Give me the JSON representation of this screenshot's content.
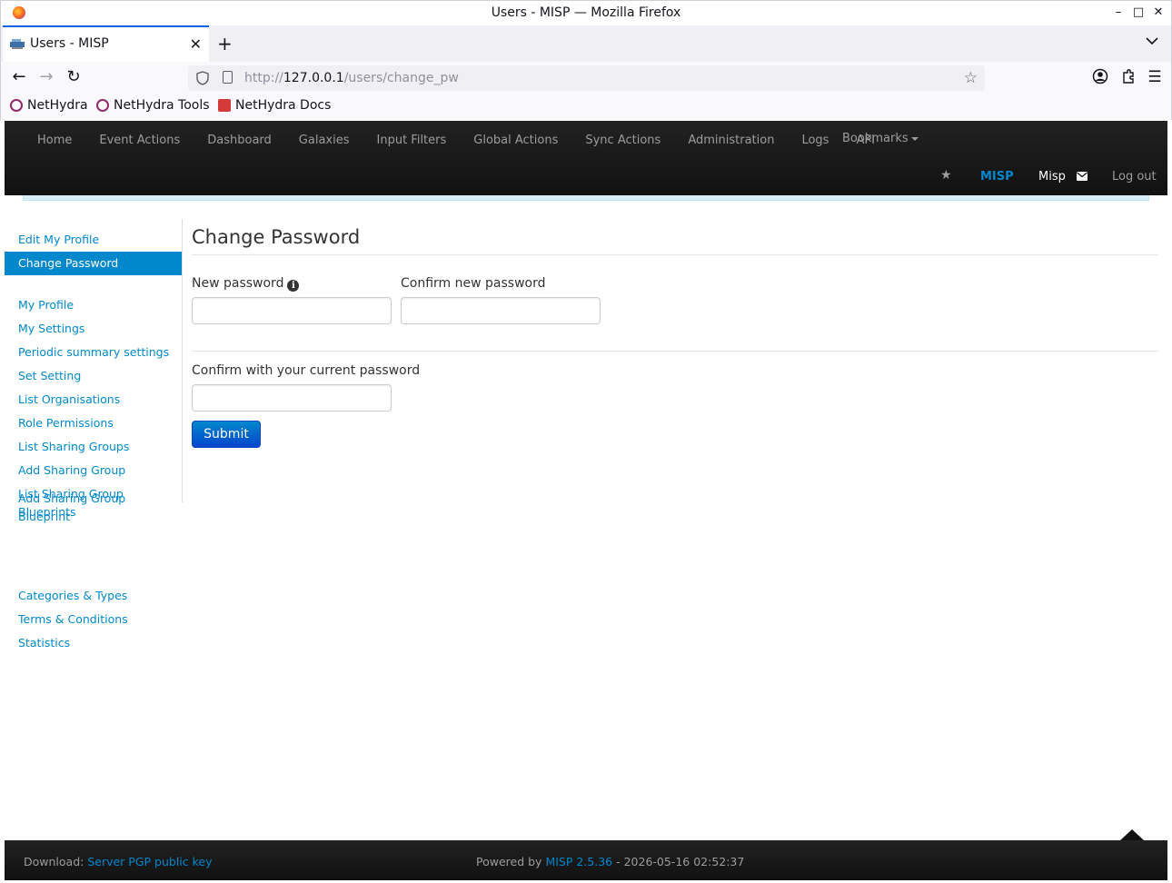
{
  "window": {
    "title": "Users - MISP — Mozilla Firefox",
    "controls": {
      "minimize": "–",
      "maximize": "□",
      "close": "✕"
    }
  },
  "tab": {
    "title": "Users - MISP",
    "close": "✕",
    "new_tab": "+",
    "list_tabs": "⌄"
  },
  "navigation": {
    "back": "←",
    "forward": "→",
    "reload": "↻",
    "url_scheme": "http://",
    "url_host": "127.0.0.1",
    "url_path": "/users/change_pw"
  },
  "bookmarks": [
    {
      "label": "NetHydra",
      "icon": "nethydra-icon"
    },
    {
      "label": "NetHydra Tools",
      "icon": "nethydra-icon"
    },
    {
      "label": "NetHydra Docs",
      "icon": "docs-icon"
    }
  ],
  "misp_nav": {
    "menu": [
      "Home",
      "Event Actions",
      "Dashboard",
      "Galaxies",
      "Input Filters",
      "Global Actions",
      "Sync Actions",
      "Administration",
      "Logs",
      "API"
    ],
    "bookmarks_label": "Bookmarks",
    "brand": "MISP",
    "user": "Misp",
    "logout": "Log out"
  },
  "sidebar": {
    "group1": [
      "Edit My Profile",
      "Change Password"
    ],
    "active": "Change Password",
    "group2": [
      "My Profile",
      "My Settings",
      "Periodic summary settings",
      "Set Setting",
      "List Organisations",
      "Role Permissions",
      "List Sharing Groups",
      "Add Sharing Group"
    ],
    "list_blueprints": [
      "List Sharing Group",
      "Blueprints"
    ],
    "add_blueprint": [
      "Add Sharing Group",
      "Blueprint"
    ],
    "group3": [
      "Categories & Types",
      "Terms & Conditions",
      "Statistics"
    ]
  },
  "form": {
    "title": "Change Password",
    "new_password_label": "New password",
    "confirm_new_label": "Confirm new password",
    "current_password_label": "Confirm with your current password",
    "new_password_value": "",
    "confirm_new_value": "",
    "current_password_value": "",
    "submit_label": "Submit"
  },
  "footer": {
    "download_prefix": "Download: ",
    "download_link": "Server PGP public key",
    "powered_prefix": "Powered by ",
    "powered_link": "MISP 2.5.36",
    "powered_suffix": " - 2026-05-16 02:52:37"
  },
  "colors": {
    "accent": "#0088cc",
    "navbar_bg": "#1b1b1b",
    "nav_text": "#9d9d9d",
    "button_top": "#0088cc",
    "button_bottom": "#0044cc"
  }
}
